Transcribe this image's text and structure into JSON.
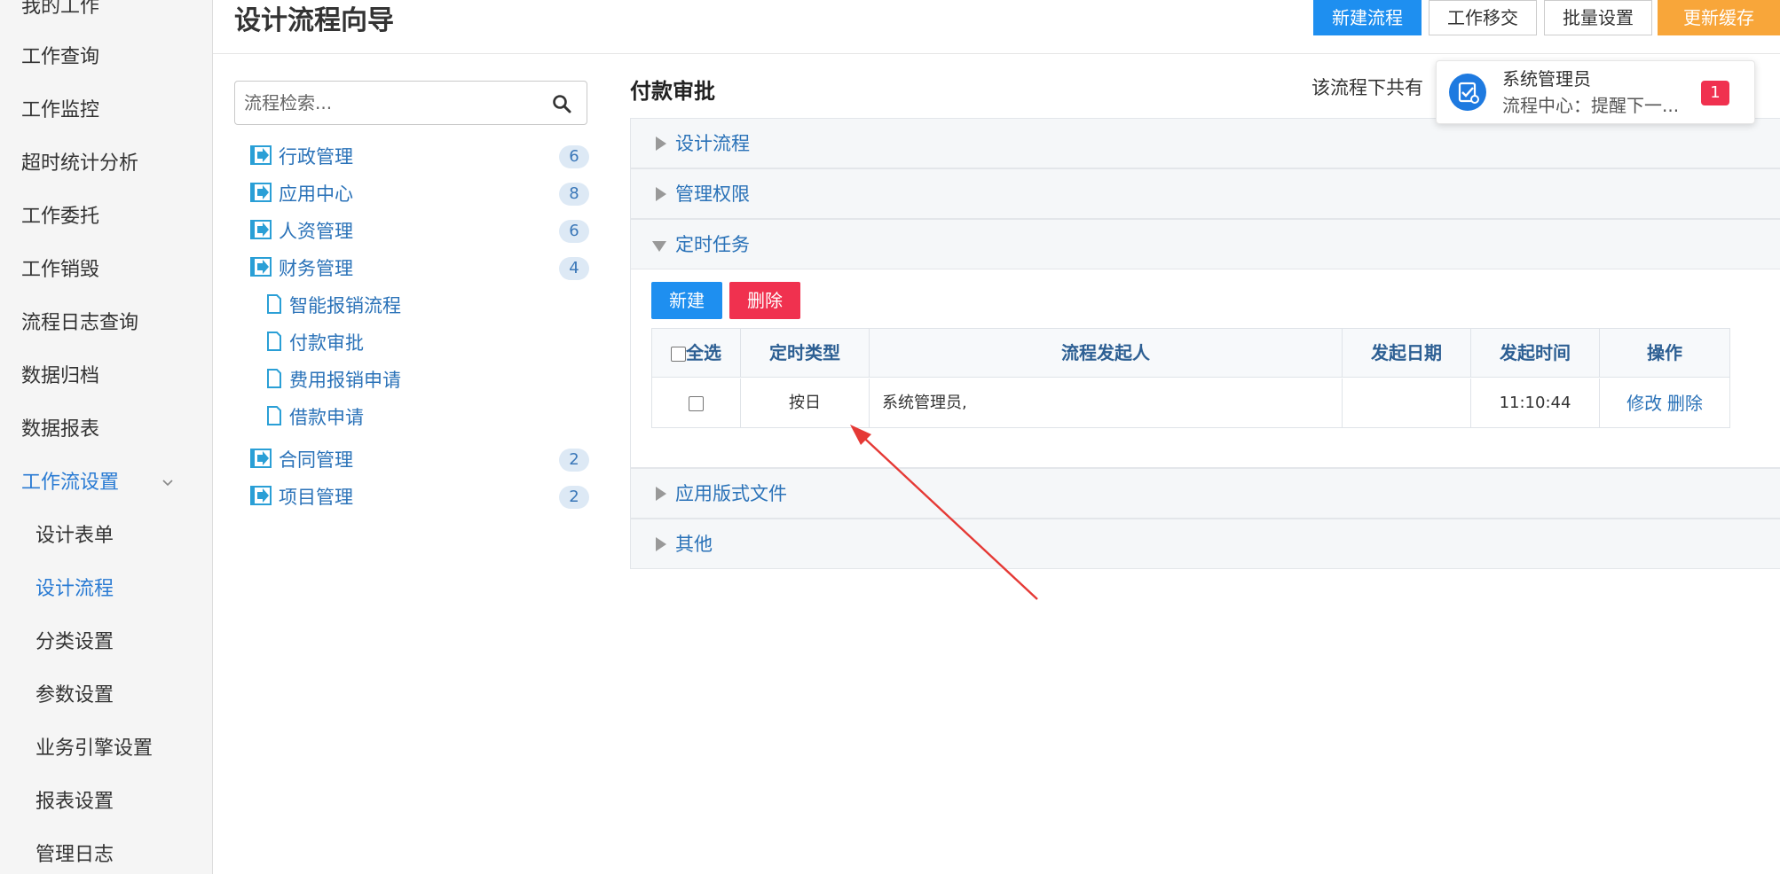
{
  "sidebar": {
    "items": [
      {
        "label": "我的工作"
      },
      {
        "label": "工作查询"
      },
      {
        "label": "工作监控"
      },
      {
        "label": "超时统计分析"
      },
      {
        "label": "工作委托"
      },
      {
        "label": "工作销毁"
      },
      {
        "label": "流程日志查询"
      },
      {
        "label": "数据归档"
      },
      {
        "label": "数据报表"
      },
      {
        "label": "工作流设置"
      }
    ],
    "sub_items": [
      {
        "label": "设计表单"
      },
      {
        "label": "设计流程"
      },
      {
        "label": "分类设置"
      },
      {
        "label": "参数设置"
      },
      {
        "label": "业务引擎设置"
      },
      {
        "label": "报表设置"
      },
      {
        "label": "管理日志"
      }
    ]
  },
  "header": {
    "title": "设计流程向导",
    "buttons": {
      "new_flow": "新建流程",
      "transfer": "工作移交",
      "batch": "批量设置",
      "refresh_cache": "更新缓存"
    }
  },
  "search": {
    "placeholder": "流程检索..."
  },
  "tree": {
    "categories": [
      {
        "label": "行政管理",
        "count": "6"
      },
      {
        "label": "应用中心",
        "count": "8"
      },
      {
        "label": "人资管理",
        "count": "6"
      },
      {
        "label": "财务管理",
        "count": "4"
      },
      {
        "label": "合同管理",
        "count": "2"
      },
      {
        "label": "项目管理",
        "count": "2"
      }
    ],
    "finance_children": [
      {
        "label": "智能报销流程"
      },
      {
        "label": "付款审批"
      },
      {
        "label": "费用报销申请"
      },
      {
        "label": "借款申请"
      }
    ]
  },
  "main": {
    "flow_title": "付款审批",
    "flow_count_text": "该流程下共有",
    "sections": {
      "design_flow": "设计流程",
      "permissions": "管理权限",
      "scheduled_tasks": "定时任务",
      "layout_files": "应用版式文件",
      "other": "其他"
    },
    "actions": {
      "new": "新建",
      "delete": "删除"
    },
    "table": {
      "headers": {
        "select_all": "全选",
        "type": "定时类型",
        "initiator": "流程发起人",
        "date": "发起日期",
        "time": "发起时间",
        "ops": "操作"
      },
      "rows": [
        {
          "type": "按日",
          "initiator": "系统管理员,",
          "date": "",
          "time": "11:10:44",
          "edit": "修改",
          "delete": "删除"
        }
      ]
    }
  },
  "notification": {
    "title": "系统管理员",
    "message": "流程中心：提醒下一...",
    "count": "1"
  },
  "colors": {
    "primary_blue": "#1e8ff0",
    "link_blue": "#2a72b8",
    "danger_red": "#f0314f",
    "warning_orange": "#f8a63a",
    "annotation_red": "#e53935"
  }
}
